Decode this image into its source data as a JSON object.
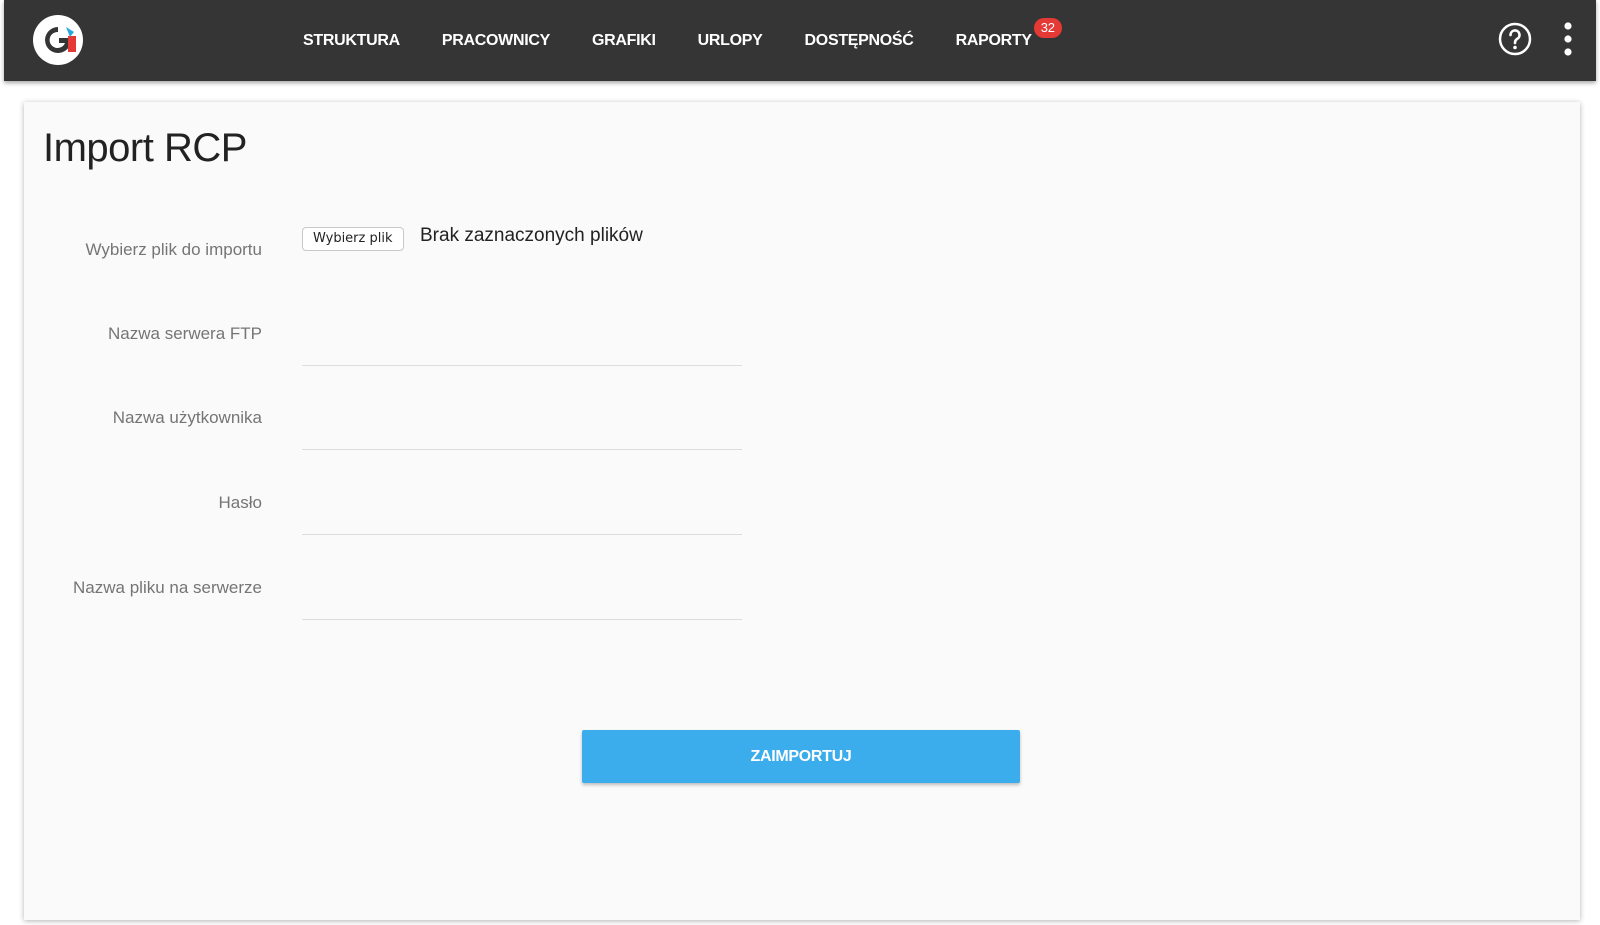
{
  "nav": {
    "items": [
      {
        "label": "STRUKTURA"
      },
      {
        "label": "PRACOWNICY"
      },
      {
        "label": "GRAFIKI"
      },
      {
        "label": "URLOPY"
      },
      {
        "label": "DOSTĘPNOŚĆ"
      },
      {
        "label": "RAPORTY",
        "badge": "32"
      }
    ]
  },
  "page": {
    "title": "Import RCP"
  },
  "form": {
    "file": {
      "label": "Wybierz plik do importu",
      "button": "Wybierz plik",
      "status": "Brak zaznaczonych plików"
    },
    "ftp_server": {
      "label": "Nazwa serwera FTP",
      "value": ""
    },
    "username": {
      "label": "Nazwa użytkownika",
      "value": ""
    },
    "password": {
      "label": "Hasło",
      "value": ""
    },
    "remote_file": {
      "label": "Nazwa pliku na serwerze",
      "value": ""
    },
    "submit_label": "ZAIMPORTUJ"
  },
  "colors": {
    "topbar": "#353535",
    "accent": "#3badec",
    "badge": "#e53935",
    "logo_blue": "#29a8e0",
    "logo_red": "#e53935"
  },
  "icons": {
    "logo": "app-logo-g",
    "help": "help-circle-icon",
    "more": "more-vertical-icon"
  }
}
